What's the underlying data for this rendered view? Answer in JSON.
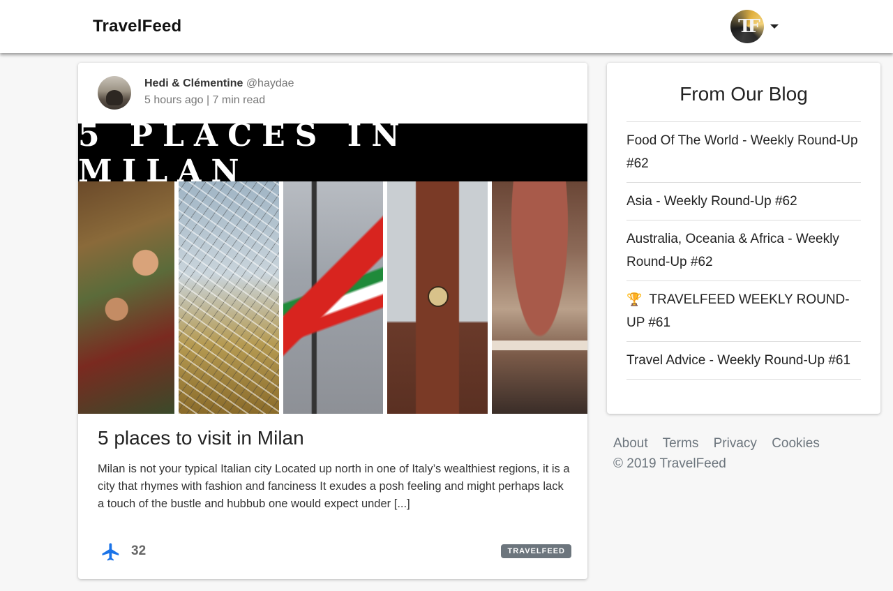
{
  "header": {
    "brand": "TravelFeed",
    "user_monogram": "TF"
  },
  "post": {
    "author_name": "Hedi & Clémentine",
    "author_handle": "@haydae",
    "meta": "5 hours ago | 7 min read",
    "image_banner_text": "5 PLACES IN MILAN",
    "title": "5 places to visit in Milan",
    "excerpt": "Milan is not your typical Italian city Located up north in one of Italy’s wealthiest regions, it is a city that rhymes with fashion and fanciness It exudes a posh feeling and might perhaps lack a touch of the bustle and hubbub one would expect under [...]",
    "vote_count": "32",
    "tag": "TRAVELFEED",
    "vote_icon": "airplane-icon",
    "accent_color": "#1a73e8"
  },
  "blog": {
    "heading": "From Our Blog",
    "items": [
      {
        "label": "Food Of The World - Weekly Round-Up #62"
      },
      {
        "label": "Asia - Weekly Round-Up #62"
      },
      {
        "label": "Australia, Oceania & Africa - Weekly Round-Up #62"
      },
      {
        "label": "TRAVELFEED WEEKLY ROUND-UP #61",
        "icon": "trophy-icon"
      },
      {
        "label": "Travel Advice - Weekly Round-Up #61"
      }
    ]
  },
  "footer": {
    "links": [
      "About",
      "Terms",
      "Privacy",
      "Cookies"
    ],
    "copyright": "© 2019 TravelFeed"
  }
}
